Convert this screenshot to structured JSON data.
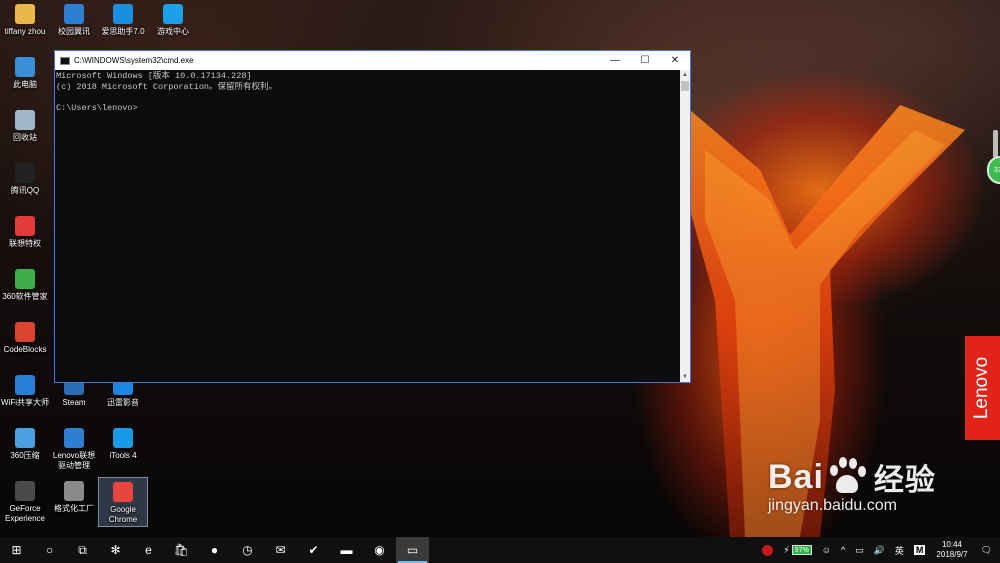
{
  "desktop": {
    "icons": [
      {
        "label": "tiffany zhou",
        "icon": "folder-user-icon",
        "color": "#e8b84a"
      },
      {
        "label": "校园翼讯",
        "icon": "network-app-icon",
        "color": "#2d7fd3"
      },
      {
        "label": "爱思助手7.0",
        "icon": "aisi-helper-icon",
        "color": "#1a8fe0"
      },
      {
        "label": "游戏中心",
        "icon": "game-center-icon",
        "color": "#1ca0e6"
      },
      {
        "label": "此电脑",
        "icon": "this-pc-icon",
        "color": "#3b8fd8"
      },
      {
        "label": "回收站",
        "icon": "recycle-bin-icon",
        "color": "#9fb7c9"
      },
      {
        "label": "腾讯QQ",
        "icon": "qq-icon",
        "color": "#222222"
      },
      {
        "label": "联想特权",
        "icon": "lenovo-privilege-icon",
        "color": "#e23b3b"
      },
      {
        "label": "360软件管家",
        "icon": "360-software-icon",
        "color": "#3fae49"
      },
      {
        "label": "CodeBlocks",
        "icon": "codeblocks-icon",
        "color": "#d9452f"
      },
      {
        "label": "WiFi共享大师",
        "icon": "wifi-share-icon",
        "color": "#2a7fd5"
      },
      {
        "label": "Steam",
        "icon": "steam-icon",
        "color": "#2b6db5"
      },
      {
        "label": "迅雷影音",
        "icon": "xunlei-player-icon",
        "color": "#1c86e0"
      },
      {
        "label": "360压缩",
        "icon": "360-zip-icon",
        "color": "#4aa0e0"
      },
      {
        "label": "Lenovo联想驱动管理",
        "icon": "lenovo-driver-icon",
        "color": "#2d7fd3"
      },
      {
        "label": "iTools 4",
        "icon": "itools-icon",
        "color": "#1a9ae6"
      },
      {
        "label": "GeForce Experience",
        "icon": "geforce-icon",
        "color": "#4a4a4a"
      },
      {
        "label": "格式化工厂",
        "icon": "format-factory-icon",
        "color": "#8a8a8a"
      },
      {
        "label": "Google Chrome",
        "icon": "chrome-icon",
        "color": "#e8453c"
      }
    ]
  },
  "cmd_window": {
    "title": "C:\\WINDOWS\\system32\\cmd.exe",
    "line1": "Microsoft Windows [版本 10.0.17134.228]",
    "line2": "(c) 2018 Microsoft Corporation。保留所有权利。",
    "line3": "",
    "line4": "C:\\Users\\lenovo>",
    "minimize": "—",
    "maximize": "☐",
    "close": "✕"
  },
  "brand_badge": "Lenovo",
  "side_widget": "37",
  "watermark": {
    "logo_left": "Bai",
    "logo_right": "经验",
    "url": "jingyan.baidu.com"
  },
  "taskbar": {
    "start": "⊞",
    "search": "○",
    "task_view": "⧉",
    "pinned": [
      {
        "name": "pinwheel-app-icon",
        "glyph": "✻"
      },
      {
        "name": "edge-icon",
        "glyph": "e"
      },
      {
        "name": "store-icon",
        "glyph": "🛍"
      },
      {
        "name": "record-app-icon",
        "glyph": "●"
      },
      {
        "name": "clock-app-icon",
        "glyph": "◷"
      },
      {
        "name": "mail-icon",
        "glyph": "✉"
      },
      {
        "name": "feedback-icon",
        "glyph": "✔"
      },
      {
        "name": "file-explorer-icon",
        "glyph": "▬"
      },
      {
        "name": "media-app-icon",
        "glyph": "◉"
      },
      {
        "name": "cmd-taskbar-icon",
        "glyph": "▭"
      }
    ],
    "tray": {
      "battery": "97%",
      "people": "☺",
      "chevron": "^",
      "ime_lang": "英",
      "ime_mode": "M",
      "time": "10:44",
      "date": "2018/9/7",
      "notification": "🗨"
    }
  },
  "colors": {
    "accent": "#3d7be0",
    "taskbar": "#101010",
    "lenovo_red": "#e2231a"
  }
}
